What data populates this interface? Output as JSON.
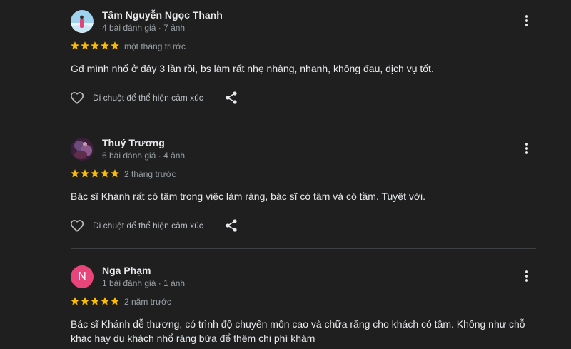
{
  "colors": {
    "background": "#1f1f1f",
    "star": "#fbbc04",
    "text": "#e8eaed",
    "muted": "#9aa0a6",
    "avatar_letter_bg": "#e8457a"
  },
  "icons": {
    "more": "more-vert-icon",
    "like": "heart-outline-icon",
    "share": "share-icon",
    "star": "star-icon"
  },
  "reviews": [
    {
      "name": "Tâm Nguyễn Ngọc Thanh",
      "meta": "4 bài đánh giá · 7 ảnh",
      "rating": 5,
      "time": "một tháng trước",
      "text": "Gđ mình nhổ ở đây 3 lần rồi, bs làm rất nhẹ nhàng, nhanh, không đau, dịch vụ tốt.",
      "react_label": "Di chuột để thể hiện cảm xúc"
    },
    {
      "name": "Thuý Trương",
      "meta": "6 bài đánh giá · 4 ảnh",
      "rating": 5,
      "time": "2 tháng trước",
      "text": "Bác sĩ Khánh rất có tâm trong việc làm răng, bác sĩ có tâm và có tầm. Tuyệt vời.",
      "react_label": "Di chuột để thể hiện cảm xúc"
    },
    {
      "name": "Nga Phạm",
      "avatar_letter": "N",
      "meta": "1 bài đánh giá · 1 ảnh",
      "rating": 5,
      "time": "2 năm trước",
      "text": "Bác sĩ Khánh dễ thương, có trình độ chuyên môn cao và chữa răng cho khách có tâm. Không như chỗ khác hay dụ khách nhổ răng bừa để thêm chi phí khám"
    }
  ]
}
